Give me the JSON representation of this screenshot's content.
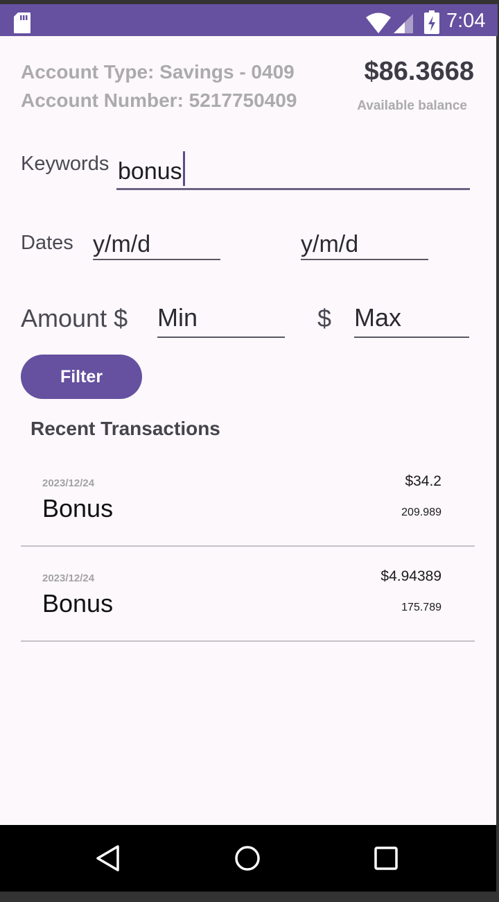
{
  "status_bar": {
    "time": "7:04",
    "icons": [
      "sd-card-icon",
      "wifi-icon",
      "signal-icon",
      "battery-charging-icon"
    ]
  },
  "account": {
    "type_line": "Account Type: Savings - 0409",
    "number_line": "Account Number: 5217750409",
    "balance": "$86.3668",
    "balance_label": "Available balance"
  },
  "filters": {
    "keywords_label": "Keywords",
    "keywords_value": "bonus",
    "dates_label": "Dates",
    "date_start_placeholder": "y/m/d",
    "date_end_placeholder": "y/m/d",
    "amount_label": "Amount $",
    "max_currency": "$",
    "amount_min_placeholder": "Min",
    "amount_max_placeholder": "Max",
    "filter_button": "Filter"
  },
  "transactions": {
    "title": "Recent Transactions",
    "items": [
      {
        "date": "2023/12/24",
        "description": "Bonus",
        "amount": "$34.2",
        "balance": "209.989"
      },
      {
        "date": "2023/12/24",
        "description": "Bonus",
        "amount": "$4.94389",
        "balance": "175.789"
      }
    ]
  },
  "nav_bar": {
    "icons": [
      "back-icon",
      "home-icon",
      "recent-apps-icon"
    ]
  },
  "colors": {
    "accent": "#6650a0",
    "background": "#fcf8fc"
  }
}
